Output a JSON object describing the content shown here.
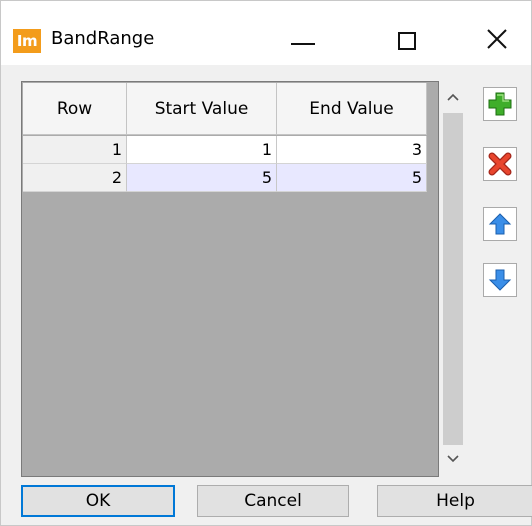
{
  "window": {
    "title": "BandRange",
    "icon_text": "Im"
  },
  "grid": {
    "columns": [
      "Row",
      "Start Value",
      "End Value"
    ],
    "rows": [
      {
        "row": "1",
        "start": "1",
        "end": "3"
      },
      {
        "row": "2",
        "start": "5",
        "end": "5"
      }
    ]
  },
  "toolbar": {
    "icons": [
      "add-icon",
      "delete-icon",
      "move-up-icon",
      "move-down-icon"
    ]
  },
  "buttons": {
    "ok": "OK",
    "cancel": "Cancel",
    "help": "Help"
  },
  "colors": {
    "icon_bg": "#f39c1b",
    "accent": "#0078d7",
    "grid_bg": "#ababab",
    "selected_row": "#e8e8ff"
  }
}
